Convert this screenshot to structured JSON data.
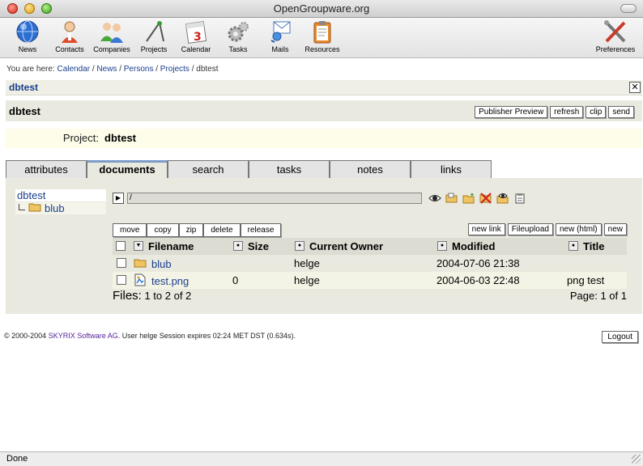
{
  "window": {
    "title": "OpenGroupware.org"
  },
  "toolbar": {
    "items": [
      {
        "label": "News",
        "icon": "globe-icon"
      },
      {
        "label": "Contacts",
        "icon": "person-icon"
      },
      {
        "label": "Companies",
        "icon": "people-icon"
      },
      {
        "label": "Projects",
        "icon": "compass-icon"
      },
      {
        "label": "Calendar",
        "icon": "calendar-icon"
      },
      {
        "label": "Tasks",
        "icon": "gears-icon"
      },
      {
        "label": "Mails",
        "icon": "envelope-icon"
      },
      {
        "label": "Resources",
        "icon": "clipboard-icon"
      }
    ],
    "preferences": {
      "label": "Preferences",
      "icon": "tools-icon"
    },
    "calendar_day": "3"
  },
  "breadcrumb": {
    "prefix": "You are here:",
    "items": [
      "Calendar",
      "News",
      "Persons",
      "Projects"
    ],
    "current": "dbtest"
  },
  "header": {
    "name": "dbtest",
    "close": "✕"
  },
  "titlebar": {
    "title": "dbtest",
    "buttons": [
      "Publisher Preview",
      "refresh",
      "clip",
      "send"
    ]
  },
  "project": {
    "label": "Project:",
    "value": "dbtest"
  },
  "tabs": [
    "attributes",
    "documents",
    "search",
    "tasks",
    "notes",
    "links"
  ],
  "active_tab": "documents",
  "tree": {
    "root": "dbtest",
    "child": "blub"
  },
  "path": {
    "value": "/"
  },
  "file_actions": {
    "left": [
      "move",
      "copy",
      "zip",
      "delete",
      "release"
    ],
    "right": [
      "new link",
      "Fileupload",
      "new (html)",
      "new"
    ]
  },
  "grid": {
    "columns": [
      "Filename",
      "Size",
      "Current Owner",
      "Modified",
      "Title"
    ],
    "rows": [
      {
        "name": "blub",
        "type": "folder",
        "size": "",
        "owner": "helge",
        "modified": "2004-07-06 21:38",
        "title": ""
      },
      {
        "name": "test.png",
        "type": "image",
        "size": "0",
        "owner": "helge",
        "modified": "2004-06-03 22:48",
        "title": "png test"
      }
    ],
    "footer": {
      "files_label": "Files:",
      "range": "1 to 2 of 2",
      "page": "Page: 1 of 1"
    }
  },
  "footer": {
    "copyright": "© 2000-2004",
    "company": "SKYRIX Software AG",
    "session": ". User helge Session expires 02:24 MET DST (0.634s).",
    "logout": "Logout"
  },
  "status": {
    "text": "Done"
  }
}
